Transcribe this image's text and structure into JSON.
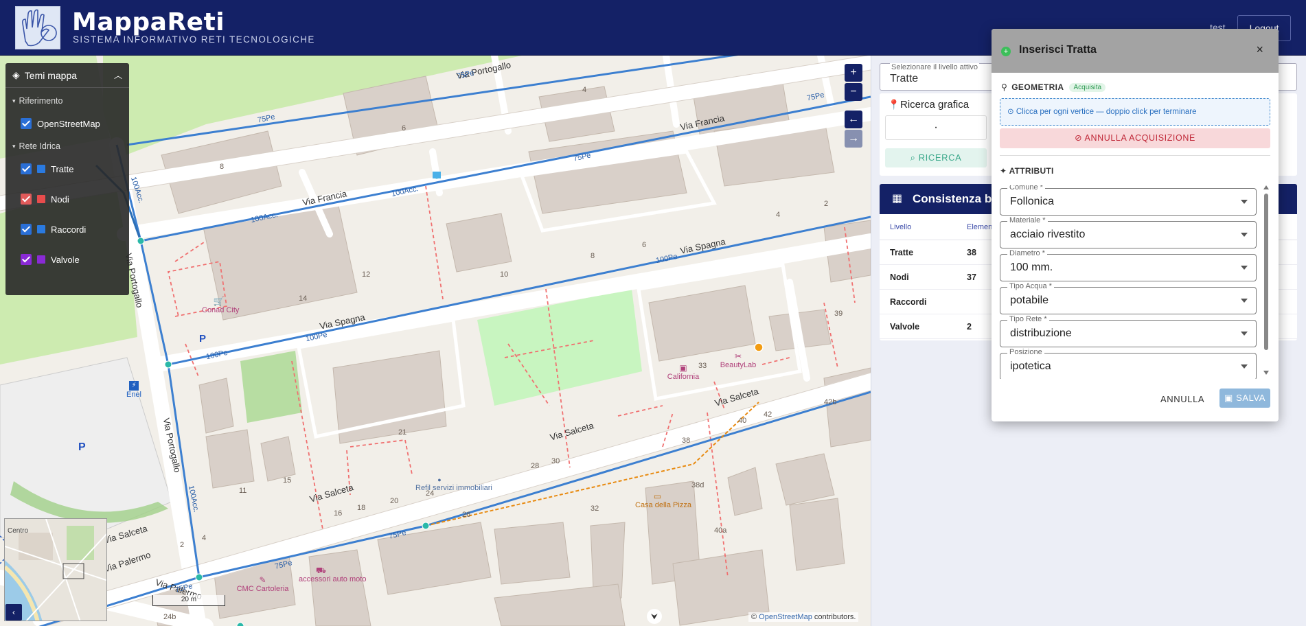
{
  "header": {
    "title": "MappaReti",
    "subtitle": "SISTEMA INFORMATIVO RETI TECNOLOGICHE",
    "user": "test",
    "logout_label": "Logout"
  },
  "layers_panel": {
    "title": "Temi mappa",
    "groups": [
      {
        "label": "Riferimento",
        "items": [
          {
            "label": "OpenStreetMap",
            "checked": true,
            "checkbox_color": "#2a6fd6",
            "swatch": null
          }
        ]
      },
      {
        "label": "Rete Idrica",
        "items": [
          {
            "label": "Tratte",
            "checked": true,
            "checkbox_color": "#2a6fd6",
            "swatch": "#2a7ae0"
          },
          {
            "label": "Nodi",
            "checked": true,
            "checkbox_color": "#e05a5a",
            "swatch": "#e84c4c"
          },
          {
            "label": "Raccordi",
            "checked": true,
            "checkbox_color": "#2a6fd6",
            "swatch": "#2a7ae0"
          },
          {
            "label": "Valvole",
            "checked": true,
            "checkbox_color": "#8a2ad6",
            "swatch": "#8a2ad6"
          }
        ]
      }
    ]
  },
  "map": {
    "zoom_in": "+",
    "zoom_out": "−",
    "nav_back": "←",
    "nav_forward": "→",
    "minimap_toggle": "‹",
    "minimap_label": "Centro",
    "scale_label": "20 m",
    "attribution_prefix": "©",
    "attribution_link": "OpenStreetMap",
    "attribution_suffix": "contributors.",
    "streets": [
      "Via Portogallo",
      "Via Francia",
      "Via Spagna",
      "Via Salceta",
      "Via Salceta",
      "Via Salceta",
      "Via Portogallo",
      "Via Salceta",
      "Via Palermo",
      "Via Palermo"
    ],
    "pipe_labels": [
      "75Pe",
      "75Pe",
      "75Pe",
      "75Pe",
      "100Acc.",
      "100Acc.",
      "100Acc.",
      "100Pe",
      "100Pe",
      "100Pe",
      "75Pe",
      "75Pe",
      "75Pe",
      "100Acc."
    ],
    "pois": [
      {
        "name": "Conad City",
        "color": "#b0407a"
      },
      {
        "name": "Enel",
        "color": "#2060c0"
      },
      {
        "name": "California",
        "color": "#b0407a"
      },
      {
        "name": "BeautyLab",
        "color": "#b0407a"
      },
      {
        "name": "Refil servizi immobiliari",
        "color": "#5070a0"
      },
      {
        "name": "Casa della Pizza",
        "color": "#c07010"
      },
      {
        "name": "CMC Cartoleria",
        "color": "#b0407a"
      },
      {
        "name": "accessori auto moto",
        "color": "#b0407a"
      }
    ],
    "house_numbers": [
      "4",
      "6",
      "8",
      "12",
      "14",
      "10",
      "8",
      "6",
      "4",
      "2",
      "39",
      "33",
      "38",
      "42",
      "42b",
      "40",
      "38d",
      "40a",
      "32",
      "28",
      "30",
      "26",
      "24",
      "20",
      "18",
      "16",
      "15",
      "21",
      "11",
      "4",
      "2",
      "24b"
    ],
    "pipe_color": "#3c7fd0",
    "edit_line_color": "#e88a10",
    "node_color": "#2ab8a8",
    "service_line_color": "#f07070",
    "parking_letter": "P"
  },
  "right_panel": {
    "level_select": {
      "label": "Selezionare il livello attivo",
      "value": "Tratte"
    },
    "search": {
      "title": "Ricerca grafica",
      "field_value": "·",
      "button_label": "RICERCA"
    },
    "consistency": {
      "title": "Consistenza banca dati",
      "columns": [
        "Livello",
        "Elementi"
      ],
      "rows": [
        {
          "level": "Tratte",
          "count": "38"
        },
        {
          "level": "Nodi",
          "count": "37"
        },
        {
          "level": "Raccordi",
          "count": ""
        },
        {
          "level": "Valvole",
          "count": "2"
        }
      ]
    }
  },
  "dialog": {
    "title": "Inserisci Tratta",
    "close": "×",
    "geometry_label": "GEOMETRIA",
    "geometry_badge": "Acquisita",
    "hint": "Clicca per ogni vertice — doppio click per terminare",
    "cancel_acquisition": "ANNULLA ACQUISIZIONE",
    "attributes_label": "ATTRIBUTI",
    "fields": [
      {
        "label": "Comune *",
        "value": "Follonica"
      },
      {
        "label": "Materiale *",
        "value": "acciaio rivestito"
      },
      {
        "label": "Diametro *",
        "value": "100 mm."
      },
      {
        "label": "Tipo Acqua *",
        "value": "potabile"
      },
      {
        "label": "Tipo Rete *",
        "value": "distribuzione"
      },
      {
        "label": "Posizione",
        "value": "ipotetica"
      }
    ],
    "cancel_label": "ANNULLA",
    "save_label": "SALVA"
  }
}
